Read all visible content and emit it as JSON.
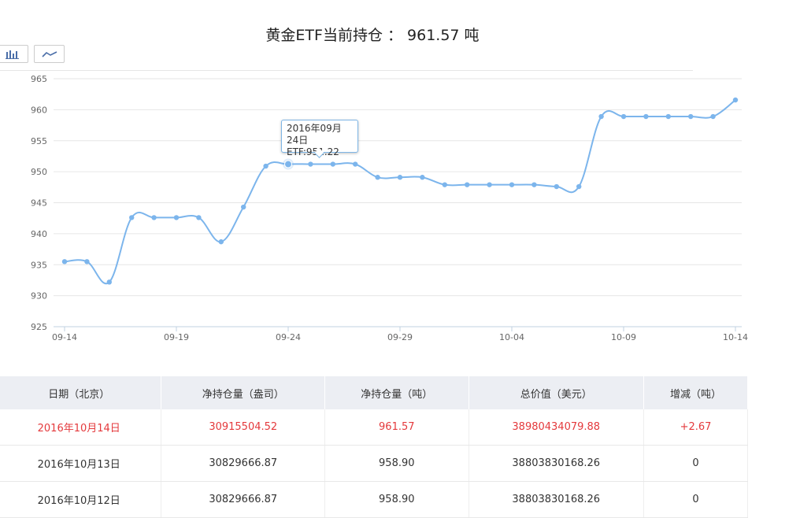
{
  "page_title": "黄金ETF当前持仓 ： 961.57 吨",
  "tooltip": {
    "date": "2016年09月24日",
    "value": "ETF:951.22"
  },
  "colors": {
    "line": "#7cb5ec",
    "grid": "#e6e6e6",
    "axis_text": "#666666",
    "highlight": "#e4393c"
  },
  "icons": {
    "bar_view": "bar-chart-icon",
    "line_view": "line-chart-icon"
  },
  "chart_data": {
    "type": "line",
    "title": "",
    "xlabel": "",
    "ylabel": "",
    "ylim": [
      925,
      965
    ],
    "yticks": [
      925,
      930,
      935,
      940,
      945,
      950,
      955,
      960,
      965
    ],
    "xtick_labels": [
      "09-14",
      "09-19",
      "09-24",
      "09-29",
      "10-04",
      "10-09",
      "10-14"
    ],
    "xtick_index": [
      0,
      5,
      10,
      15,
      20,
      25,
      30
    ],
    "grid": true,
    "x": [
      "09-14",
      "09-15",
      "09-16",
      "09-17",
      "09-18",
      "09-19",
      "09-20",
      "09-21",
      "09-22",
      "09-23",
      "09-24",
      "09-25",
      "09-26",
      "09-27",
      "09-28",
      "09-29",
      "09-30",
      "10-01",
      "10-02",
      "10-03",
      "10-04",
      "10-05",
      "10-06",
      "10-07",
      "10-08",
      "10-09",
      "10-10",
      "10-11",
      "10-12",
      "10-13",
      "10-14"
    ],
    "series": [
      {
        "name": "ETF",
        "values": [
          935.5,
          935.5,
          932.2,
          942.6,
          942.6,
          942.6,
          942.6,
          938.7,
          944.3,
          950.9,
          951.22,
          951.22,
          951.22,
          951.22,
          949.1,
          949.1,
          949.1,
          947.9,
          947.9,
          947.9,
          947.9,
          947.9,
          947.6,
          947.6,
          958.9,
          958.9,
          958.9,
          958.9,
          958.9,
          958.9,
          961.57
        ]
      }
    ]
  },
  "table": {
    "headers": [
      "日期（北京）",
      "净持仓量（盎司）",
      "净持仓量（吨）",
      "总价值（美元）",
      "增减（吨）"
    ],
    "rows": [
      [
        "2016年10月14日",
        "30915504.52",
        "961.57",
        "38980434079.88",
        "+2.67"
      ],
      [
        "2016年10月13日",
        "30829666.87",
        "958.90",
        "38803830168.26",
        "0"
      ],
      [
        "2016年10月12日",
        "30829666.87",
        "958.90",
        "38803830168.26",
        "0"
      ]
    ]
  }
}
